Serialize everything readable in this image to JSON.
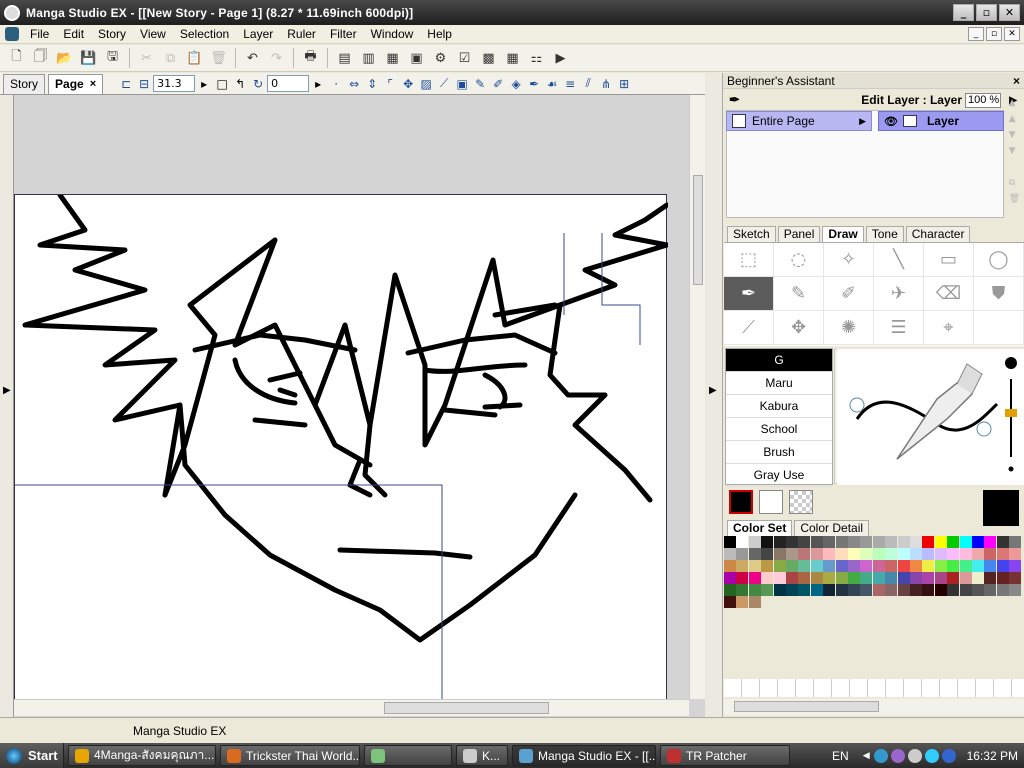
{
  "window": {
    "title": "Manga Studio EX - [[New Story - Page 1] (8.27 * 11.69inch 600dpi)]"
  },
  "menu": [
    "File",
    "Edit",
    "Story",
    "View",
    "Selection",
    "Layer",
    "Ruler",
    "Filter",
    "Window",
    "Help"
  ],
  "doc_tabs": [
    {
      "label": "Story"
    },
    {
      "label": "Page",
      "active": true,
      "close": "×"
    }
  ],
  "doc_toolbar": {
    "zoom_value": "31.3",
    "rotate_value": "0"
  },
  "status": {
    "text": "Manga Studio EX"
  },
  "assistant": {
    "title": "Beginner's Assistant",
    "close": "×",
    "edit_layer_label": "Edit Layer : Layer",
    "opacity": "100 %",
    "entire_page": "Entire Page",
    "layer_name": "Layer"
  },
  "tool_tabs": [
    {
      "label": "Sketch"
    },
    {
      "label": "Panel"
    },
    {
      "label": "Draw",
      "active": true
    },
    {
      "label": "Tone"
    },
    {
      "label": "Character"
    }
  ],
  "brushes": [
    "G",
    "Maru",
    "Kabura",
    "School",
    "Brush",
    "Gray Use"
  ],
  "selected_brush": "G",
  "color_tabs": [
    {
      "label": "Color Set",
      "active": true
    },
    {
      "label": "Color Detail"
    }
  ],
  "colors": {
    "main": "#000000",
    "sub": "#ffffff",
    "accent_sel": "#cc0000"
  },
  "taskbar": {
    "start": "Start",
    "tasks": [
      {
        "label": "4Manga-สังคมคุณภา...",
        "color": "#e8a400"
      },
      {
        "label": "Trickster Thai World...",
        "color": "#d86b20"
      },
      {
        "label": "",
        "color": "#7cc47c"
      },
      {
        "label": "K...",
        "color": "#cccccc"
      },
      {
        "label": "Manga Studio EX - [[...",
        "color": "#5aa0d0",
        "active": true
      },
      {
        "label": "TR Patcher",
        "color": "#c03030"
      }
    ],
    "lang": "EN",
    "clock": "16:32 PM"
  }
}
